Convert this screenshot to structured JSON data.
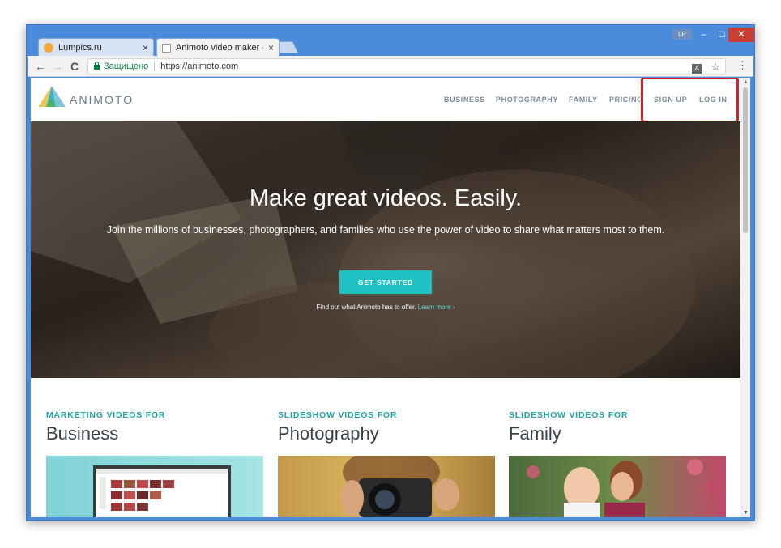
{
  "browser": {
    "tabs": [
      {
        "title": "Lumpics.ru",
        "close": "×",
        "favicon_color": "#f2a93b"
      },
      {
        "title": "Animoto video maker - S",
        "close": "×",
        "favicon_color": "#888888"
      }
    ],
    "user_badge": "LP",
    "window_buttons": {
      "minimize": "–",
      "maximize": "□",
      "close": "✕"
    },
    "nav": {
      "back": "←",
      "forward": "→",
      "reload": "C"
    },
    "address": {
      "lock_icon": "lock-icon",
      "secure_label": "Защищено",
      "url": "https://animoto.com"
    },
    "omnibox_icons": {
      "translate": "translate-icon",
      "star": "☆"
    },
    "menu": "⋮"
  },
  "site": {
    "logo_text": "ANIMOTO",
    "nav": [
      {
        "label": "BUSINESS"
      },
      {
        "label": "PHOTOGRAPHY"
      },
      {
        "label": "FAMILY"
      },
      {
        "label": "PRICING"
      },
      {
        "label": "SIGN UP"
      },
      {
        "label": "LOG IN"
      }
    ],
    "hero": {
      "title": "Make great videos. Easily.",
      "subtitle": "Join the millions of businesses, photographers, and families who use the power of video to share what matters most to them.",
      "cta": "GET STARTED",
      "findout_text": "Find out what Animoto has to offer.",
      "learn_more": "Learn more ›"
    },
    "categories": [
      {
        "kicker": "MARKETING VIDEOS FOR",
        "name": "Business"
      },
      {
        "kicker": "SLIDESHOW VIDEOS FOR",
        "name": "Photography"
      },
      {
        "kicker": "SLIDESHOW VIDEOS FOR",
        "name": "Family"
      }
    ],
    "colors": {
      "accent": "#1fc1c3",
      "kicker": "#1fa5a8",
      "highlight": "#e01b24"
    }
  }
}
